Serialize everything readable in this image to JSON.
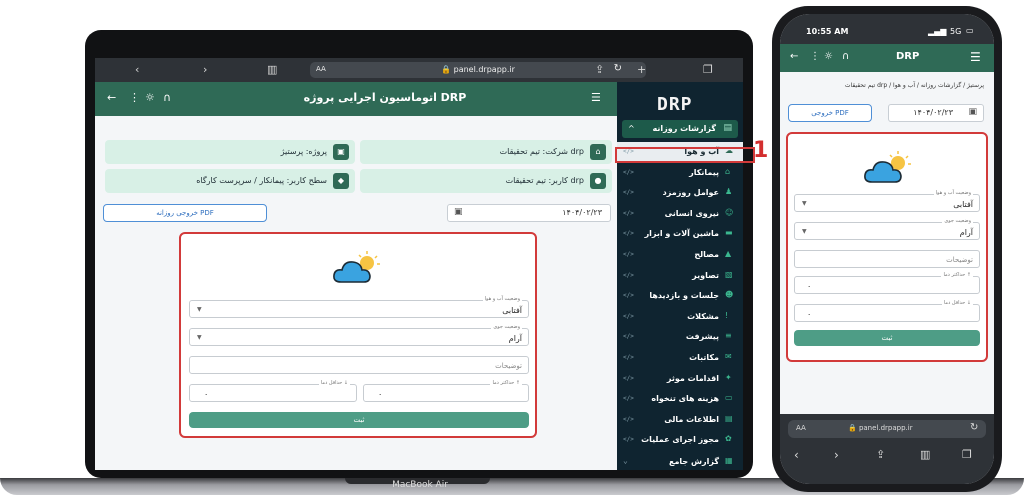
{
  "browser": {
    "url": "panel.drpapp.ir",
    "aa_label": "AA"
  },
  "app": {
    "title": "اتوماسیون اجرایی پروژه DRP",
    "logo": "DRP"
  },
  "sidebar": {
    "section_label": "گزارشات روزانه",
    "items": [
      {
        "label": "آب و هوا",
        "code": "</>",
        "active": true
      },
      {
        "label": "پیمانکار",
        "code": "</>"
      },
      {
        "label": "عوامل روزمزد",
        "code": "</>"
      },
      {
        "label": "نیروی انسانی",
        "code": "</>"
      },
      {
        "label": "ماشین آلات و ابزار",
        "code": "</>"
      },
      {
        "label": "مصالح",
        "code": "</>"
      },
      {
        "label": "تصاویر",
        "code": "</>"
      },
      {
        "label": "جلسات و بازدیدها",
        "code": "</>"
      },
      {
        "label": "مشکلات",
        "code": "</>"
      },
      {
        "label": "پیشرفت",
        "code": "</>"
      },
      {
        "label": "مکاتبات",
        "code": "</>"
      },
      {
        "label": "اقدامات موثر",
        "code": "</>"
      },
      {
        "label": "هزینه های تنخواه",
        "code": "</>"
      },
      {
        "label": "اطلاعات مالی",
        "code": "</>"
      },
      {
        "label": "مجوز اجرای عملیات",
        "code": "</>"
      }
    ],
    "footer_label": "گزارش جامع"
  },
  "info_cards": {
    "company": "شرکت: تیم تحقیقات drp",
    "project": "پروژه: پرستیژ",
    "user": "کاربر: تیم تحقیقات drp",
    "user_level": "سطح کاربر: پیمانکار / سرپرست کارگاه"
  },
  "toolbar": {
    "pdf_label": "خروجی روزانه PDF",
    "date": "۱۴۰۴/۰۲/۲۳"
  },
  "form": {
    "weather_label": "وضعیت آب و هوا",
    "weather_value": "آفتابی",
    "air_label": "وضعیت جوی",
    "air_value": "آرام",
    "description_placeholder": "توضیحات",
    "max_temp_label": "حداکثر دما ↑",
    "min_temp_label": "حداقل دما ↓",
    "max_temp_value": "۰",
    "min_temp_value": "۰",
    "submit_label": "ثبت"
  },
  "annotation": {
    "number": "1"
  },
  "laptop": {
    "model": "MacBook Air"
  },
  "phone": {
    "time": "10:55 AM",
    "signal": "5G",
    "nav_title": "DRP",
    "breadcrumb": "تیم تحقیقات drp / پرستیژ / گزارشات روزانه / آب و هوا",
    "pdf_label": "خروجی PDF",
    "date": "۱۴۰۴/۰۲/۲۳",
    "url": "panel.drpapp.ir",
    "aa_label": "AA"
  },
  "colors": {
    "primary": "#2f6a56",
    "sidebar": "#0f2430",
    "accent_card": "#d8f0e6",
    "submit": "#4e9d86",
    "highlight": "#d23a3a"
  }
}
